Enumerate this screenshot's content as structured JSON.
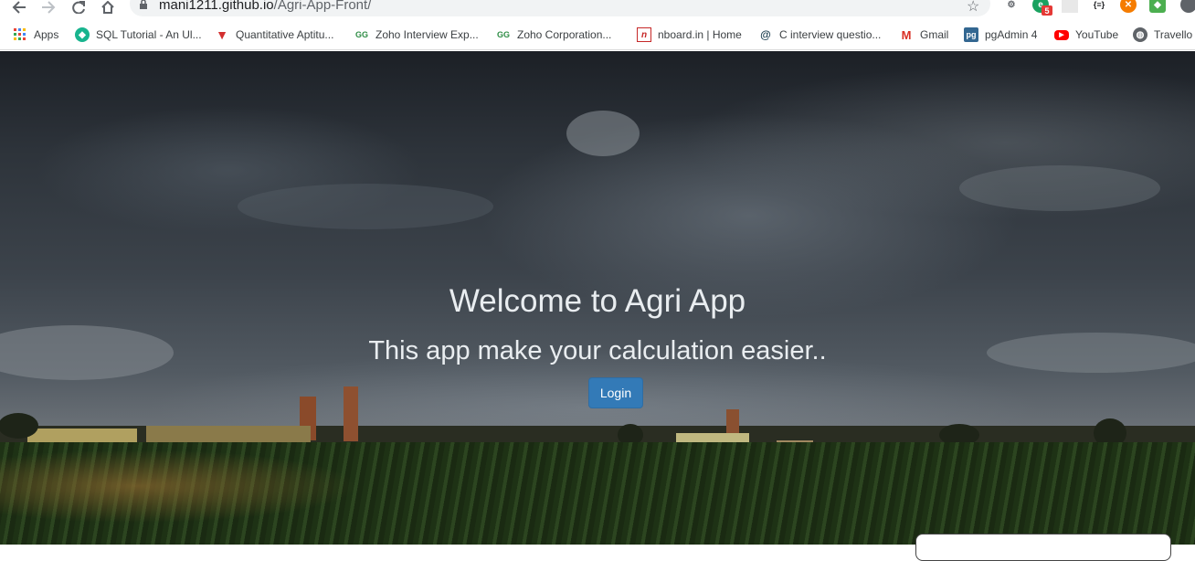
{
  "browser": {
    "url_domain": "mani1211.github.io",
    "url_path": "/Agri-App-Front/"
  },
  "bookmarks": [
    {
      "label": "Apps",
      "icon": "apps-grid-icon"
    },
    {
      "label": "SQL Tutorial - An Ul...",
      "icon": "sql-tutorial-icon"
    },
    {
      "label": "Quantitative Aptitu...",
      "icon": "quantitative-icon"
    },
    {
      "label": "Zoho Interview Exp...",
      "icon": "gfg-icon"
    },
    {
      "label": "Zoho Corporation...",
      "icon": "gfg-icon"
    },
    {
      "label": "nboard.in | Home",
      "icon": "nboard-icon"
    },
    {
      "label": "C interview questio...",
      "icon": "c-interview-icon"
    },
    {
      "label": "Gmail",
      "icon": "gmail-icon"
    },
    {
      "label": "pgAdmin 4",
      "icon": "pgadmin-icon"
    },
    {
      "label": "YouTube",
      "icon": "youtube-icon"
    },
    {
      "label": "Travello",
      "icon": "globe-icon"
    }
  ],
  "extensions": {
    "badge_count": "5"
  },
  "hero": {
    "title": "Welcome to Agri App",
    "subtitle": "This app make your calculation easier..",
    "login_label": "Login"
  }
}
